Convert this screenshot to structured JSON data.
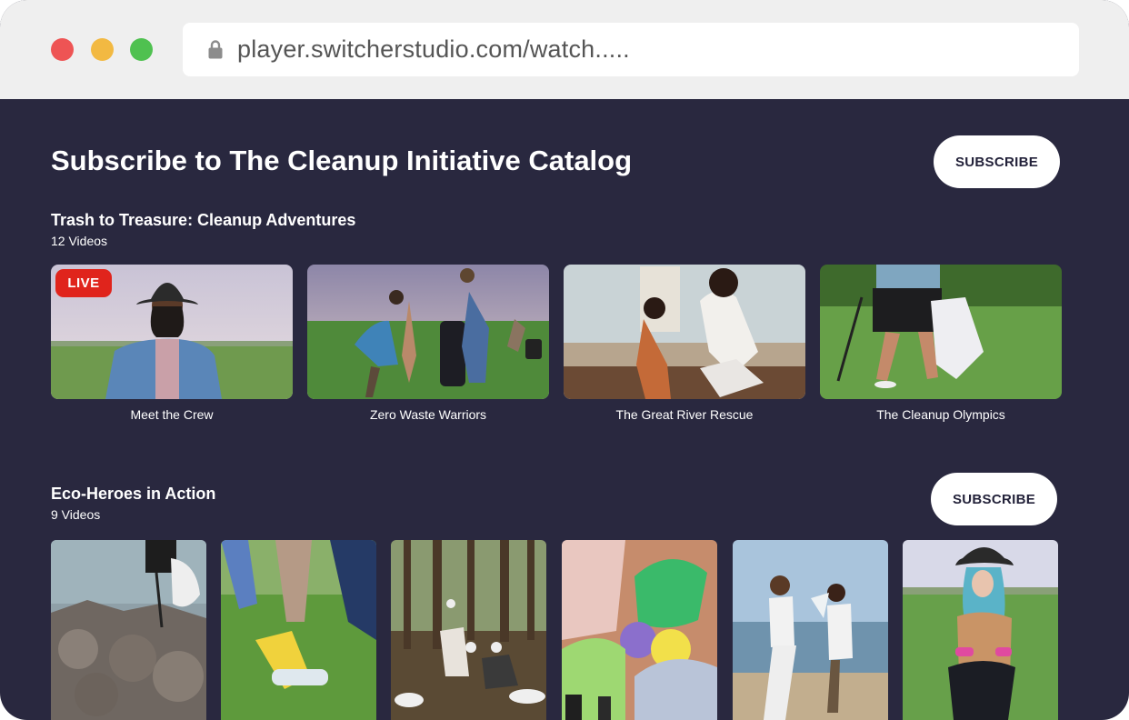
{
  "browser": {
    "url": "player.switcherstudio.com/watch....."
  },
  "page": {
    "title": "Subscribe to The Cleanup Initiative Catalog",
    "subscribe_label": "SUBSCRIBE"
  },
  "sections": [
    {
      "title": "Trash to Treasure: Cleanup Adventures",
      "count": "12 Videos",
      "videos": [
        {
          "label": "Meet the Crew",
          "badge": "LIVE"
        },
        {
          "label": "Zero Waste Warriors"
        },
        {
          "label": "The Great River Rescue"
        },
        {
          "label": "The Cleanup Olympics"
        }
      ]
    },
    {
      "title": "Eco-Heroes in Action",
      "count": "9 Videos",
      "subscribe_label": "SUBSCRIBE"
    }
  ],
  "colors": {
    "background": "#29283f",
    "live": "#e0241c",
    "button_text": "#23223a"
  }
}
